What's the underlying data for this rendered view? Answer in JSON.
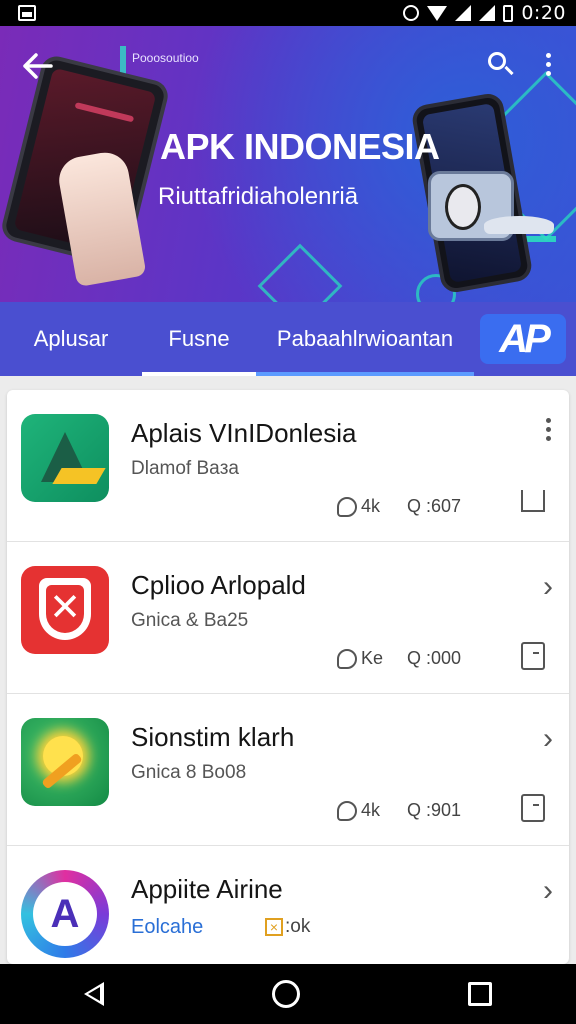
{
  "status_bar": {
    "time": "0:20"
  },
  "header": {
    "small_label": "Pooosoutioo",
    "title": "APK INDONESIA",
    "subtitle": "Riuttafridiaholenriā"
  },
  "tabs": [
    {
      "label": "Aplusar",
      "selected": false
    },
    {
      "label": "Fusne",
      "selected": true
    },
    {
      "label": "Pabaahlrwioantan",
      "selected": false
    }
  ],
  "brand_logo_text": "AP",
  "apps": [
    {
      "title": "Aplais VInIDonlesia",
      "subtitle": "Dlamof Baзa",
      "stat1": "4k",
      "stat2": "Q :607",
      "action_icon": "more-vert-icon",
      "side_icon": "bookmark-icon"
    },
    {
      "title": "Cplioo Arlopald",
      "subtitle": "Gnica & Ba25",
      "stat1": "Ke",
      "stat2": "Q :000",
      "action_icon": "chevron-right-icon",
      "side_icon": "document-icon"
    },
    {
      "title": "Sionstim klarh",
      "subtitle": "Gnica 8 Bo08",
      "stat1": "4k",
      "stat2": "Q :901",
      "action_icon": "chevron-right-icon",
      "side_icon": "document-icon"
    },
    {
      "title": "Appiite Airine",
      "link": "Eolcahe",
      "badge": ":ok",
      "action_icon": "chevron-right-icon"
    }
  ],
  "colors": {
    "tab_bar": "#4a4fd0",
    "tab_indicator_selected": "#ffffff",
    "tab_indicator_secondary": "#5c9bff",
    "link": "#2a6fd6"
  }
}
